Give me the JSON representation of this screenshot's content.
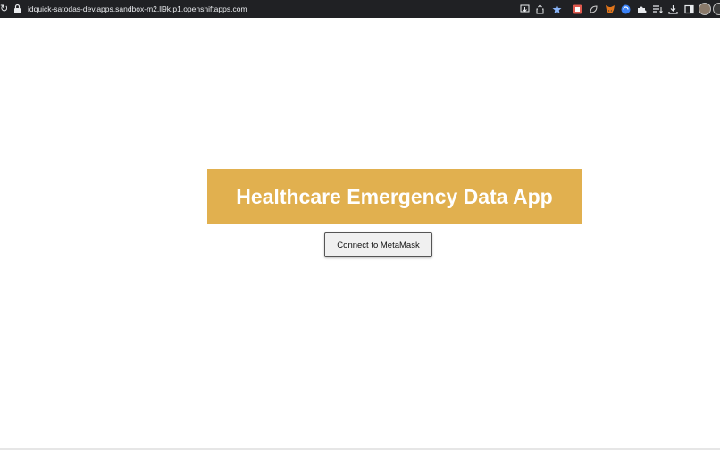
{
  "browser": {
    "url": "idquick-satodas-dev.apps.sandbox-m2.ll9k.p1.openshiftapps.com",
    "icons": [
      "reload-icon",
      "lock-icon",
      "install-icon",
      "share-icon",
      "bookmark-star-icon",
      "extension-red-icon",
      "extension-leaf-icon",
      "metamask-fox-icon",
      "extension-blue-icon",
      "extensions-puzzle-icon",
      "reading-list-icon",
      "download-icon",
      "side-panel-icon",
      "profile-avatar"
    ],
    "colors": {
      "toolbar_bg": "#202124",
      "toolbar_text": "#e8eaed",
      "star": "#8ab4f8"
    }
  },
  "page": {
    "title": "Healthcare Emergency Data App",
    "connect_button": "Connect to MetaMask",
    "colors": {
      "banner_bg": "#e1b04f",
      "title_text": "#ffffff",
      "button_bg": "#f0f0f0",
      "button_border": "#555555"
    }
  }
}
